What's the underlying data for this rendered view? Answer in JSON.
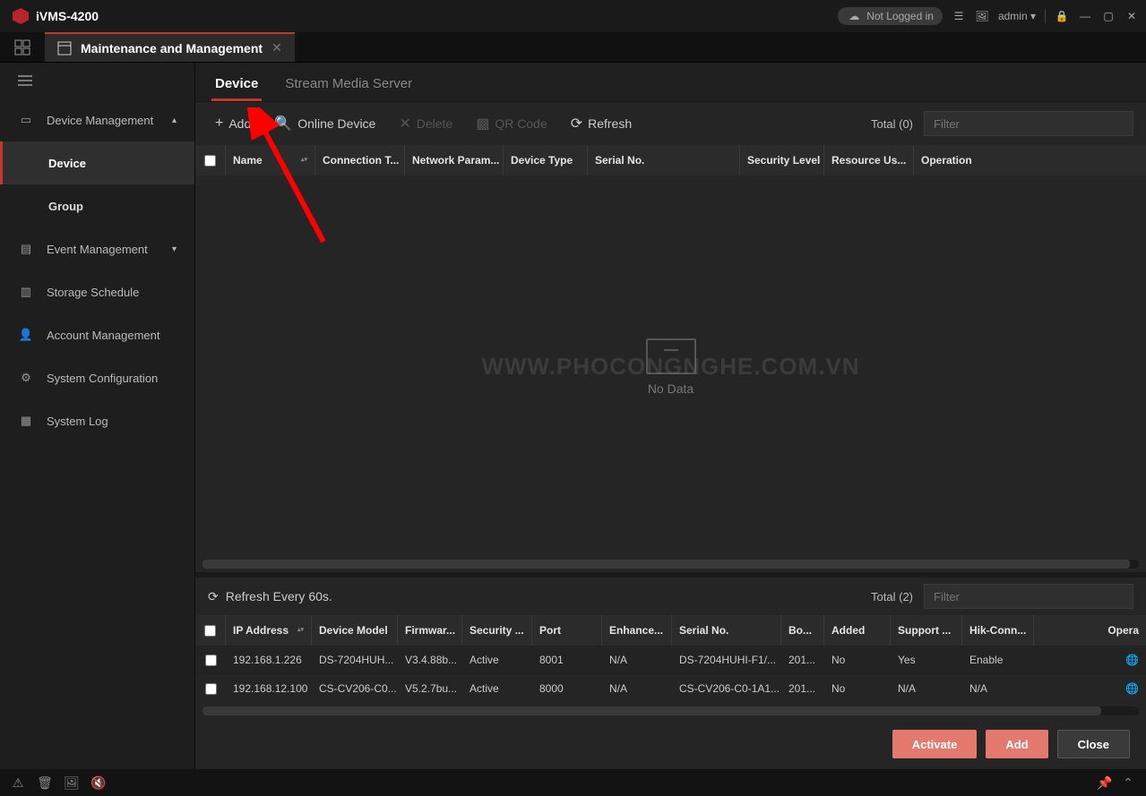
{
  "app": {
    "name": "iVMS-4200"
  },
  "titlebar": {
    "login_status": "Not Logged in",
    "user": "admin"
  },
  "workspace_tab": {
    "title": "Maintenance and Management"
  },
  "sidebar": {
    "items": [
      {
        "label": "Device Management",
        "expanded": true
      },
      {
        "label": "Device",
        "sub": true,
        "active": true
      },
      {
        "label": "Group",
        "sub": true
      },
      {
        "label": "Event Management",
        "collapsed": true
      },
      {
        "label": "Storage Schedule"
      },
      {
        "label": "Account Management"
      },
      {
        "label": "System Configuration"
      },
      {
        "label": "System Log"
      }
    ]
  },
  "subtabs": {
    "device": "Device",
    "stream": "Stream Media Server"
  },
  "toolbar": {
    "add": "Add",
    "online": "Online Device",
    "delete": "Delete",
    "qr": "QR Code",
    "refresh": "Refresh",
    "total_prefix": "Total",
    "total_count": "(0)",
    "filter_placeholder": "Filter"
  },
  "upper_table": {
    "columns": {
      "name": "Name",
      "connection": "Connection T...",
      "network": "Network Param...",
      "device_type": "Device Type",
      "serial": "Serial No.",
      "security": "Security Level",
      "resource": "Resource Us...",
      "operation": "Operation"
    },
    "empty_text": "No Data",
    "watermark": "WWW.PHOCONGNGHE.COM.VN"
  },
  "lower_toolbar": {
    "refresh_text": "Refresh Every 60s.",
    "total_prefix": "Total",
    "total_count": "(2)",
    "filter_placeholder": "Filter"
  },
  "lower_table": {
    "columns": {
      "ip": "IP Address",
      "model": "Device Model",
      "firmware": "Firmwar...",
      "security": "Security ...",
      "port": "Port",
      "enhanced": "Enhance...",
      "serial": "Serial No.",
      "boot": "Bo...",
      "added": "Added",
      "support": "Support ...",
      "hik": "Hik-Conn...",
      "operation": "Opera"
    },
    "rows": [
      {
        "ip": "192.168.1.226",
        "model": "DS-7204HUH...",
        "fw": "V3.4.88b...",
        "sec": "Active",
        "port": "8001",
        "enh": "N/A",
        "ser": "DS-7204HUHI-F1/...",
        "boot": "201...",
        "added": "No",
        "sup": "Yes",
        "hik": "Enable"
      },
      {
        "ip": "192.168.12.100",
        "model": "CS-CV206-C0...",
        "fw": "V5.2.7bu...",
        "sec": "Active",
        "port": "8000",
        "enh": "N/A",
        "ser": "CS-CV206-C0-1A1...",
        "boot": "201...",
        "added": "No",
        "sup": "N/A",
        "hik": "N/A"
      }
    ]
  },
  "actions": {
    "activate": "Activate",
    "add": "Add",
    "close": "Close"
  }
}
